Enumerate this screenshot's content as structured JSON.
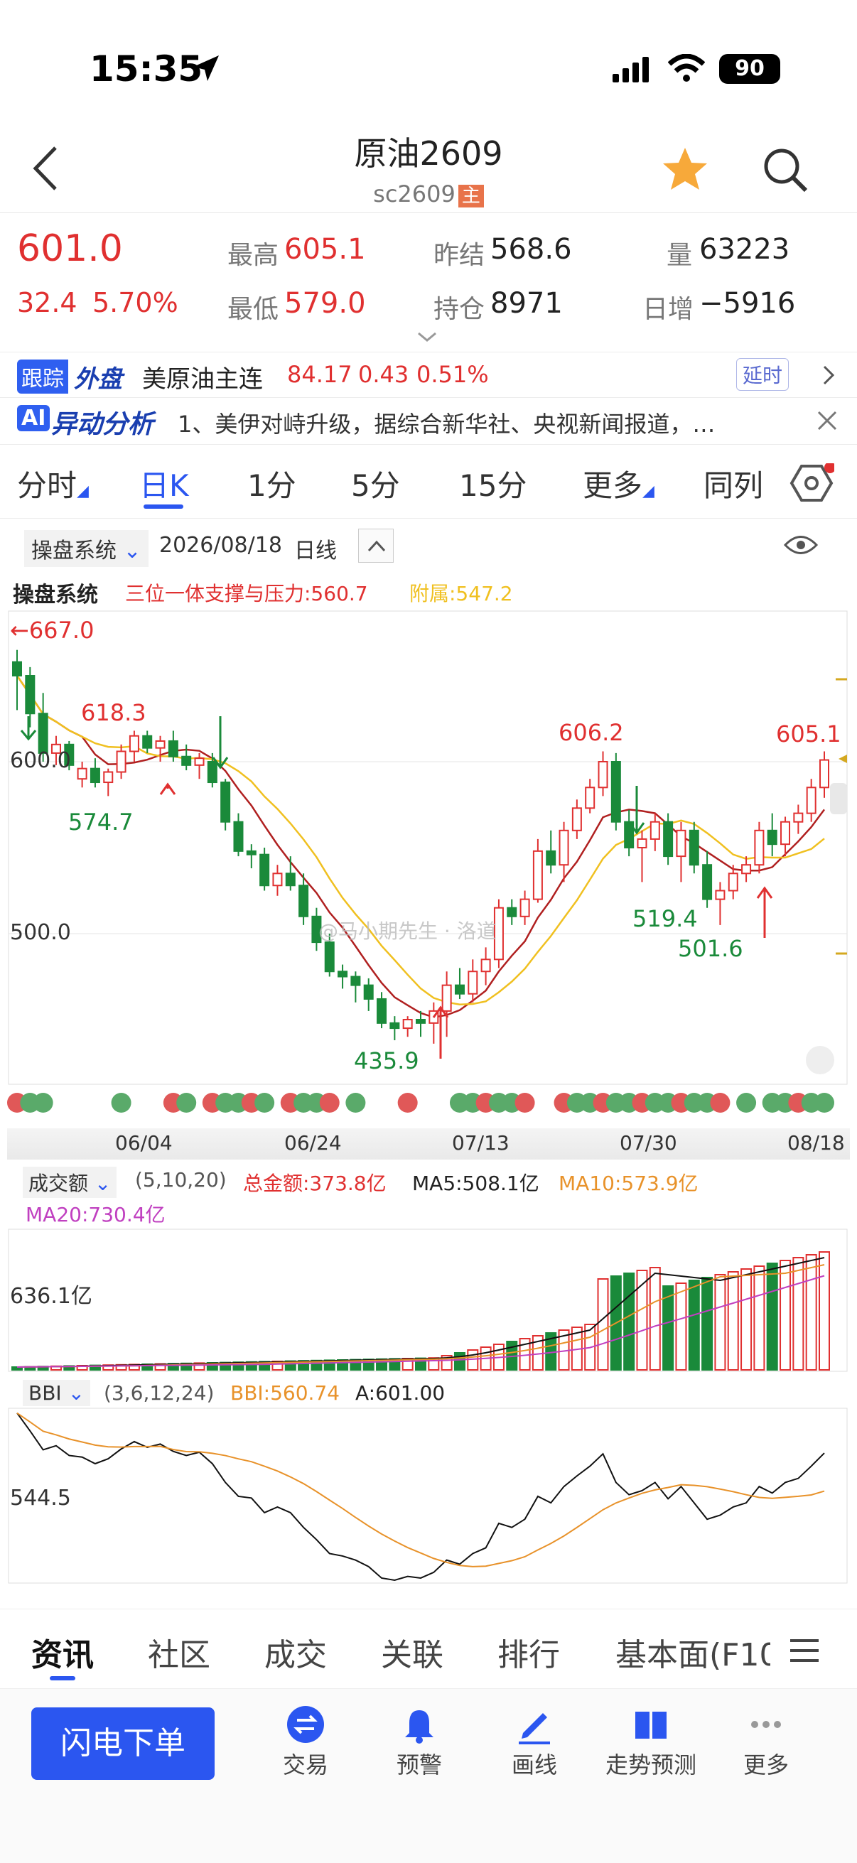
{
  "status": {
    "time": "15:35",
    "battery": "90"
  },
  "header": {
    "title": "原油2609",
    "code": "sc2609",
    "main_badge": "主"
  },
  "quote": {
    "price": "601.0",
    "change": "32.4",
    "pct": "5.70%",
    "high_label": "最高",
    "high": "605.1",
    "low_label": "最低",
    "low": "579.0",
    "prev_label": "昨结",
    "prev": "568.6",
    "oi_label": "持仓",
    "oi": "8971",
    "vol_label": "量",
    "vol": "63223",
    "daychg_label": "日增",
    "daychg": "−5916"
  },
  "ticker": {
    "badge1": "跟踪",
    "badge2": "外盘",
    "name": "美原油主连",
    "price": "84.17",
    "chg": "0.43",
    "pct": "0.51%",
    "delay": "延时"
  },
  "analysis": {
    "badge": "AI",
    "title": "异动分析",
    "text": "1、美伊对峙升级，据综合新华社、央视新闻报道，…"
  },
  "tabs": [
    "分时",
    "日K",
    "1分",
    "5分",
    "15分",
    "更多",
    "同列"
  ],
  "chart_header": {
    "system": "操盘系统",
    "date": "2026/08/18",
    "period": "日线"
  },
  "indicator": {
    "name": "操盘系统",
    "line1": "三位一体支撑与压力:560.7",
    "line2": "附属:547.2"
  },
  "labels": {
    "topleft": "←667.0",
    "y600": "600.0",
    "y500": "500.0",
    "h1": "618.3",
    "l1": "574.7",
    "h2": "606.2",
    "l2": "519.4",
    "l3": "501.6",
    "l0": "435.9",
    "h3": "605.1",
    "watermark": "@马小期先生 · 洛道"
  },
  "dates": [
    "06/04",
    "06/24",
    "07/13",
    "07/30",
    "08/18"
  ],
  "volume": {
    "name": "成交额",
    "params": "(5,10,20)",
    "total": "总金额:373.8亿",
    "ma5": "MA5:508.1亿",
    "ma10": "MA10:573.9亿",
    "ma20": "MA20:730.4亿",
    "y": "636.1亿"
  },
  "bbi": {
    "name": "BBI",
    "params": "(3,6,12,24)",
    "bbi": "BBI:560.74",
    "a": "A:601.00",
    "y": "544.5"
  },
  "bottom_tabs": [
    "资讯",
    "社区",
    "成交",
    "关联",
    "排行",
    "基本面(F10"
  ],
  "actions": {
    "order": "闪电下单",
    "items": [
      "交易",
      "预警",
      "画线",
      "走势预测",
      "更多"
    ]
  },
  "colors": {
    "up": "#e03030",
    "down": "#1a8a3a",
    "ma_red": "#b02020",
    "ma_yellow": "#f0c020",
    "accent": "#2b56f0"
  },
  "chart_data": {
    "type": "candlestick",
    "ohlc": [
      [
        658,
        665,
        630,
        650
      ],
      [
        650,
        655,
        620,
        628
      ],
      [
        628,
        640,
        600,
        605
      ],
      [
        605,
        615,
        598,
        610
      ],
      [
        610,
        612,
        595,
        598
      ],
      [
        590,
        600,
        585,
        596
      ],
      [
        596,
        602,
        585,
        588
      ],
      [
        588,
        596,
        580,
        594
      ],
      [
        594,
        610,
        590,
        606
      ],
      [
        606,
        618,
        600,
        615
      ],
      [
        615,
        618,
        605,
        608
      ],
      [
        608,
        615,
        600,
        612
      ],
      [
        612,
        618,
        600,
        603
      ],
      [
        603,
        610,
        595,
        598
      ],
      [
        598,
        605,
        590,
        602
      ],
      [
        600,
        605,
        585,
        588
      ],
      [
        588,
        590,
        560,
        565
      ],
      [
        565,
        570,
        545,
        548
      ],
      [
        548,
        552,
        538,
        546
      ],
      [
        546,
        550,
        525,
        528
      ],
      [
        528,
        540,
        522,
        535
      ],
      [
        535,
        545,
        525,
        528
      ],
      [
        528,
        535,
        505,
        510
      ],
      [
        510,
        515,
        490,
        495
      ],
      [
        495,
        500,
        475,
        478
      ],
      [
        478,
        482,
        468,
        475
      ],
      [
        475,
        478,
        460,
        470
      ],
      [
        470,
        474,
        455,
        462
      ],
      [
        462,
        466,
        445,
        448
      ],
      [
        448,
        452,
        438,
        445
      ],
      [
        445,
        452,
        440,
        450
      ],
      [
        450,
        455,
        440,
        448
      ],
      [
        448,
        460,
        436,
        455
      ],
      [
        455,
        478,
        440,
        470
      ],
      [
        470,
        480,
        462,
        465
      ],
      [
        465,
        485,
        460,
        478
      ],
      [
        478,
        492,
        470,
        485
      ],
      [
        485,
        520,
        480,
        515
      ],
      [
        515,
        520,
        505,
        510
      ],
      [
        510,
        525,
        505,
        520
      ],
      [
        520,
        555,
        518,
        548
      ],
      [
        548,
        560,
        535,
        540
      ],
      [
        540,
        565,
        530,
        560
      ],
      [
        560,
        578,
        555,
        573
      ],
      [
        573,
        590,
        570,
        585
      ],
      [
        585,
        606,
        580,
        600
      ],
      [
        600,
        605,
        560,
        565
      ],
      [
        565,
        572,
        545,
        550
      ],
      [
        550,
        560,
        530,
        555
      ],
      [
        555,
        570,
        548,
        565
      ],
      [
        565,
        570,
        540,
        545
      ],
      [
        545,
        565,
        530,
        560
      ],
      [
        560,
        565,
        535,
        540
      ],
      [
        540,
        548,
        515,
        520
      ],
      [
        520,
        530,
        505,
        525
      ],
      [
        525,
        540,
        520,
        535
      ],
      [
        535,
        545,
        530,
        540
      ],
      [
        540,
        565,
        535,
        560
      ],
      [
        560,
        570,
        545,
        552
      ],
      [
        552,
        568,
        545,
        565
      ],
      [
        565,
        575,
        558,
        570
      ],
      [
        570,
        590,
        565,
        585
      ],
      [
        585,
        606,
        579,
        601
      ]
    ],
    "dates": [
      "06/04",
      "06/24",
      "07/13",
      "07/30",
      "08/18"
    ],
    "annotations": {
      "high": [
        618.3,
        606.2,
        605.1
      ],
      "low": [
        574.7,
        435.9,
        519.4,
        501.6
      ]
    },
    "ylabels": [
      "600.0",
      "500.0"
    ]
  }
}
